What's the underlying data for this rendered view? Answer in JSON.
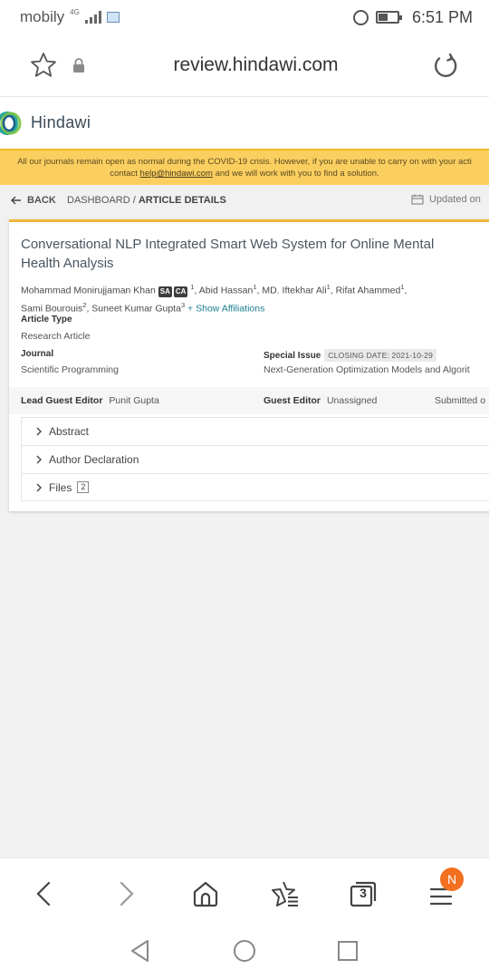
{
  "status_bar": {
    "carrier": "mobily",
    "network": "4G",
    "time": "6:51 PM"
  },
  "url_bar": {
    "url": "review.hindawi.com"
  },
  "site": {
    "brand": "Hindawi",
    "banner_line1": "All our journals remain open as normal during the COVID-19 crisis. However, if you are unable to carry on with your acti",
    "banner_line2_pre": "contact ",
    "banner_link": "help@hindawi.com",
    "banner_line2_post": " and we will work with you to find a solution."
  },
  "breadcrumb": {
    "back": "BACK",
    "dashboard": "DASHBOARD /",
    "current": "ARTICLE DETAILS",
    "updated": "Updated on"
  },
  "article": {
    "title": "Conversational NLP Integrated Smart Web System for Online Mental Health Analysis",
    "authors": [
      {
        "name": "Mohammad Monirujjaman Khan",
        "tags": [
          "SA",
          "CA"
        ],
        "sup": "1"
      },
      {
        "name": "Abid Hassan",
        "sup": "1"
      },
      {
        "name": "MD. Iftekhar Ali",
        "sup": "1"
      },
      {
        "name": "Rifat Ahammed",
        "sup": "1"
      },
      {
        "name": "Sami Bourouis",
        "sup": "2"
      },
      {
        "name": "Suneet Kumar Gupta",
        "sup": "3"
      }
    ],
    "show_affiliations": "+ Show Affiliations",
    "article_type_label": "Article Type",
    "article_type": "Research Article",
    "journal_label": "Journal",
    "journal": "Scientific Programming",
    "special_issue_label": "Special Issue",
    "closing_date": "CLOSING DATE: 2021-10-29",
    "special_issue": "Next-Generation Optimization Models and Algorit",
    "lead_editor_label": "Lead Guest Editor",
    "lead_editor": "Punit Gupta",
    "guest_editor_label": "Guest Editor",
    "guest_editor": "Unassigned",
    "submitted": "Submitted o"
  },
  "sections": [
    {
      "label": "Abstract"
    },
    {
      "label": "Author Declaration"
    },
    {
      "label": "Files",
      "count": "2"
    }
  ],
  "browser_toolbar": {
    "tab_count": "3",
    "notification": "N"
  }
}
